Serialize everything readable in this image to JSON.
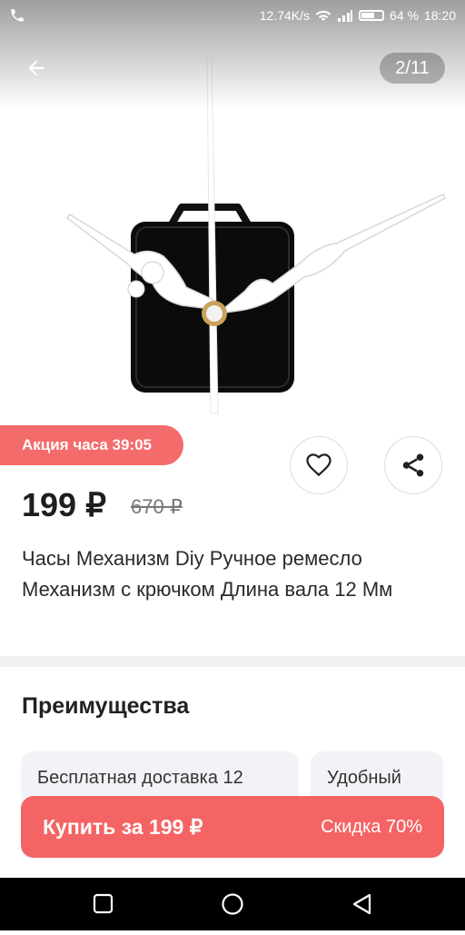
{
  "status_bar": {
    "speed": "12.74K/s",
    "battery": "64 %",
    "battery_level": 0.64,
    "time": "18:20",
    "icons": [
      "phone-icon",
      "wifi-icon",
      "signal-icon",
      "battery-icon"
    ]
  },
  "gallery": {
    "counter": "2/11"
  },
  "promo": {
    "label": "Акция часа 39:05"
  },
  "product": {
    "price": "199 ₽",
    "old_price": "670 ₽",
    "title": "Часы Механизм Diy Ручное ремесло Механизм с крючком Длина вала 12 Мм"
  },
  "advantages": {
    "title": "Преимущества",
    "cards": [
      "Бесплатная доставка 12",
      "Удобный"
    ]
  },
  "buy": {
    "label": "Купить за 199 ₽",
    "discount": "Скидка 70%"
  },
  "colors": {
    "accent": "#f46464",
    "promo": "#f46b6b",
    "text": "#222222"
  }
}
